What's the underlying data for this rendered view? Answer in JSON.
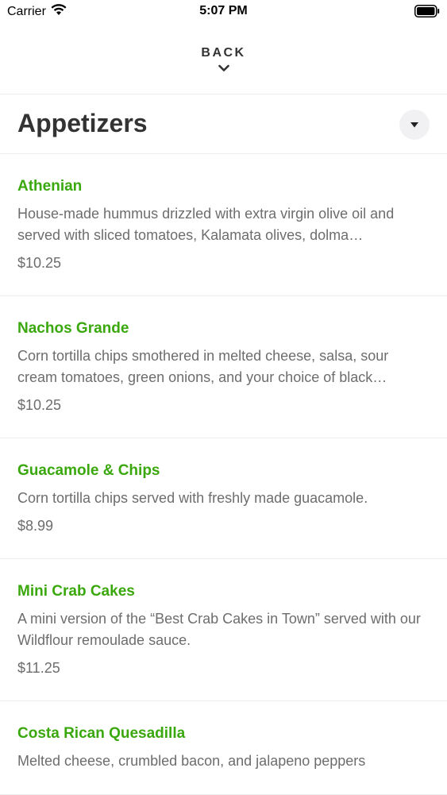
{
  "status_bar": {
    "carrier": "Carrier",
    "time": "5:07 PM"
  },
  "nav": {
    "back_label": "BACK"
  },
  "section": {
    "title": "Appetizers"
  },
  "items": [
    {
      "name": "Athenian",
      "description": "House-made hummus drizzled with extra virgin olive oil and served with sliced tomatoes, Kalamata olives, dolma…",
      "price": "$10.25"
    },
    {
      "name": "Nachos Grande",
      "description": "Corn tortilla chips smothered in melted cheese, salsa, sour cream tomatoes, green onions, and your choice of black…",
      "price": "$10.25"
    },
    {
      "name": "Guacamole & Chips",
      "description": "Corn tortilla chips served with freshly made guacamole.",
      "price": "$8.99"
    },
    {
      "name": "Mini Crab Cakes",
      "description": "A mini version of the “Best Crab Cakes in Town” served with our Wildflour remoulade sauce.",
      "price": "$11.25"
    },
    {
      "name": "Costa Rican Quesadilla",
      "description": "Melted cheese, crumbled bacon, and jalapeno peppers",
      "price": ""
    }
  ],
  "colors": {
    "accent_green": "#3aa80d",
    "text_dark": "#333333",
    "text_muted": "#6d6d6d",
    "divider": "#ececec"
  },
  "icons": {
    "wifi": "wifi-icon",
    "battery": "battery-icon",
    "back": "chevron-down-icon",
    "collapse": "caret-down-icon"
  }
}
